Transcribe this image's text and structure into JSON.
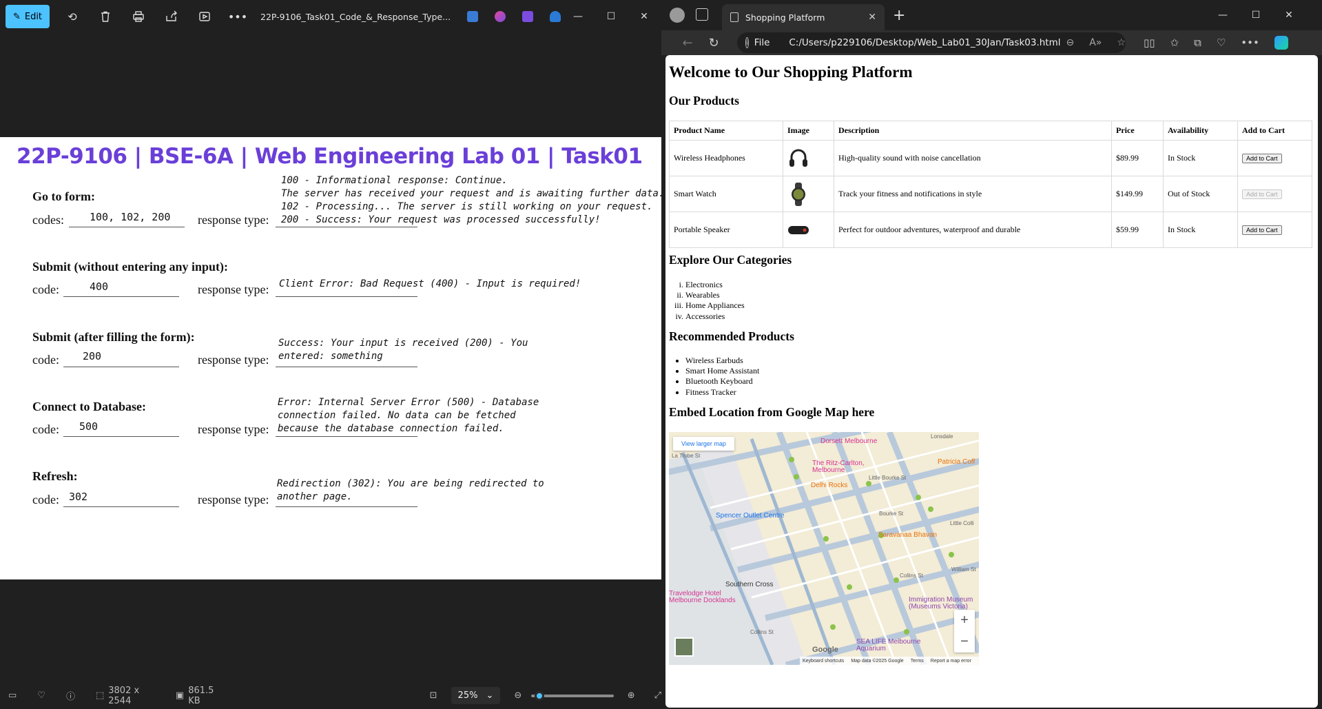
{
  "photos": {
    "edit_label": "Edit",
    "file_name": "22P-9106_Task01_Code_&_Response_Type...",
    "document": {
      "title": "22P-9106 | BSE-6A | Web Engineering Lab 01 | Task01",
      "sections": [
        {
          "heading": "Go to form:",
          "code_label": "codes:",
          "code_value": "100, 102, 200",
          "response_label": "response type:",
          "response_lines": [
            "100 - Informational response: Continue.",
            "    The server has received your request and is awaiting further data.",
            "102 - Processing... The server is still working on your request.",
            "200 - Success: Your request was processed successfully!"
          ]
        },
        {
          "heading": "Submit (without entering any input):",
          "code_label": "code:",
          "code_value": "400",
          "response_label": "response type:",
          "response_lines": [
            "Client Error: Bad Request (400) - Input is required!"
          ]
        },
        {
          "heading": "Submit (after filling the form):",
          "code_label": "code:",
          "code_value": "200",
          "response_label": "response type:",
          "response_lines": [
            "Success: Your input is received (200) - You",
            "entered: something"
          ]
        },
        {
          "heading": "Connect to Database:",
          "code_label": "code:",
          "code_value": "500",
          "response_label": "response type:",
          "response_lines": [
            "Error: Internal Server Error (500) - Database",
            "connection failed. No data can be fetched",
            "because the database connection failed."
          ]
        },
        {
          "heading": "Refresh:",
          "code_label": "code:",
          "code_value": "302",
          "response_label": "response type:",
          "response_lines": [
            "Redirection (302): You are being redirected to",
            "another page."
          ]
        }
      ]
    },
    "status": {
      "dimensions": "3802 x 2544",
      "file_size": "861.5 KB",
      "zoom": "25%",
      "zoom_fraction": 0.05
    }
  },
  "browser": {
    "tab_title": "Shopping Platform",
    "address_prefix": "File",
    "address": "C:/Users/p229106/Desktop/Web_Lab01_30Jan/Task03.html",
    "page": {
      "title": "Welcome to Our Shopping Platform",
      "products_heading": "Our Products",
      "columns": [
        "Product Name",
        "Image",
        "Description",
        "Price",
        "Availability",
        "Add to Cart"
      ],
      "products": [
        {
          "name": "Wireless Headphones",
          "description": "High-quality sound with noise cancellation",
          "price": "$89.99",
          "availability": "In Stock",
          "button": "Add to Cart",
          "icon": "headphones-icon"
        },
        {
          "name": "Smart Watch",
          "description": "Track your fitness and notifications in style",
          "price": "$149.99",
          "availability": "Out of Stock",
          "button": "Add to Cart",
          "icon": "smartwatch-icon"
        },
        {
          "name": "Portable Speaker",
          "description": "Perfect for outdoor adventures, waterproof and durable",
          "price": "$59.99",
          "availability": "In Stock",
          "button": "Add to Cart",
          "icon": "speaker-icon"
        }
      ],
      "categories_heading": "Explore Our Categories",
      "categories": [
        "Electronics",
        "Wearables",
        "Home Appliances",
        "Accessories"
      ],
      "recommended_heading": "Recommended Products",
      "recommended": [
        "Wireless Earbuds",
        "Smart Home Assistant",
        "Bluetooth Keyboard",
        "Fitness Tracker"
      ],
      "map_heading": "Embed Location from Google Map here",
      "map": {
        "view_larger": "View larger map",
        "labels": [
          "Dorsett Melbourne",
          "Lonsdale",
          "Patricia Coff",
          "La Trobe St",
          "The Ritz-Carlton, Melbourne",
          "Delhi Rocks",
          "Little Bourke St",
          "Spencer Outlet Centre",
          "Bourke St",
          "Little Colli",
          "Saravanaa Bhavan",
          "Collins St",
          "William St",
          "Southern Cross",
          "Travelodge Hotel Melbourne Docklands",
          "Immigration Museum (Museums Victoria)",
          "Collins St",
          "SEA LIFE Melbourne Aquarium"
        ],
        "google": "Google",
        "footer": [
          "Keyboard shortcuts",
          "Map data ©2025 Google",
          "Terms",
          "Report a map error"
        ]
      }
    }
  },
  "colors": {
    "edit_accent": "#4cc2ff",
    "doc_title": "#6a3fd8"
  }
}
